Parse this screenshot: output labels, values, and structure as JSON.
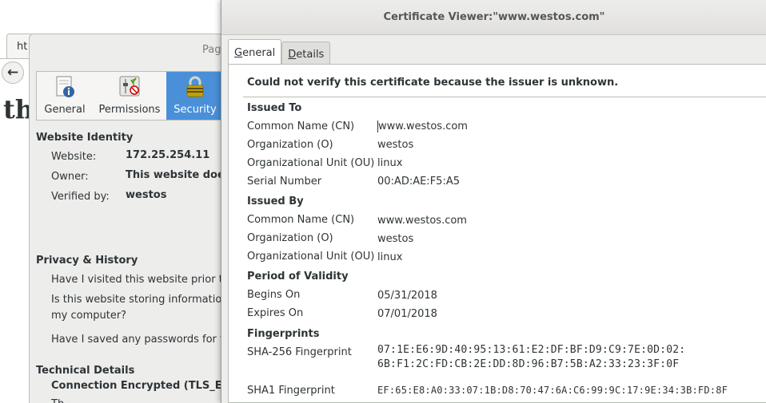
{
  "browser": {
    "tab_label": "ht",
    "page_heading_fragment": "th"
  },
  "page_info": {
    "title_fragment": "Pag",
    "tabs": [
      {
        "label": "General",
        "icon": "info-icon"
      },
      {
        "label": "Permissions",
        "icon": "permissions-icon"
      },
      {
        "label": "Security",
        "icon": "lock-icon",
        "selected": true
      }
    ],
    "website_identity": {
      "heading": "Website Identity",
      "website_label": "Website:",
      "website_value": "172.25.254.11",
      "owner_label": "Owner:",
      "owner_value": "This website does",
      "verified_label": "Verified by:",
      "verified_value": "westos"
    },
    "privacy": {
      "heading": "Privacy & History",
      "q1": "Have I visited this website prior t",
      "q2_line1": "Is this website storing informatio",
      "q2_line2": "my computer?",
      "q3": "Have I saved any passwords for t"
    },
    "technical": {
      "heading": "Technical Details",
      "connection": "Connection Encrypted (TLS_ECI",
      "cut_line": "Th"
    }
  },
  "cert_viewer": {
    "title": "Certificate Viewer:\"www.westos.com\"",
    "tabs": [
      {
        "label_underlined": "G",
        "label_rest": "eneral",
        "active": true
      },
      {
        "label_underlined": "D",
        "label_rest": "etails",
        "active": false
      }
    ],
    "message": "Could not verify this certificate because the issuer is unknown.",
    "issued_to": {
      "heading": "Issued To",
      "cn_label": "Common Name (CN)",
      "cn_value": "www.westos.com",
      "o_label": "Organization (O)",
      "o_value": "westos",
      "ou_label": "Organizational Unit (OU)",
      "ou_value": "linux",
      "serial_label": "Serial Number",
      "serial_value": "00:AD:AE:F5:A5"
    },
    "issued_by": {
      "heading": "Issued By",
      "cn_label": "Common Name (CN)",
      "cn_value": "www.westos.com",
      "o_label": "Organization (O)",
      "o_value": "westos",
      "ou_label": "Organizational Unit (OU)",
      "ou_value": "linux"
    },
    "validity": {
      "heading": "Period of Validity",
      "begins_label": "Begins On",
      "begins_value": "05/31/2018",
      "expires_label": "Expires On",
      "expires_value": "07/01/2018"
    },
    "fingerprints": {
      "heading": "Fingerprints",
      "sha256_label": "SHA-256 Fingerprint",
      "sha256_line1": "07:1E:E6:9D:40:95:13:61:E2:DF:BF:D9:C9:7E:0D:02:",
      "sha256_line2": "6B:F1:2C:FD:CB:2E:DD:8D:96:B7:5B:A2:33:23:3F:0F",
      "sha1_label": "SHA1 Fingerprint",
      "sha1_value": "EF:65:E8:A0:33:07:1B:D8:70:47:6A:C6:99:9C:17:9E:34:3B:FD:8F"
    }
  },
  "colors": {
    "selected_tab": "#4a90d9",
    "window_bg": "#ededeb",
    "text": "#2e3436"
  }
}
